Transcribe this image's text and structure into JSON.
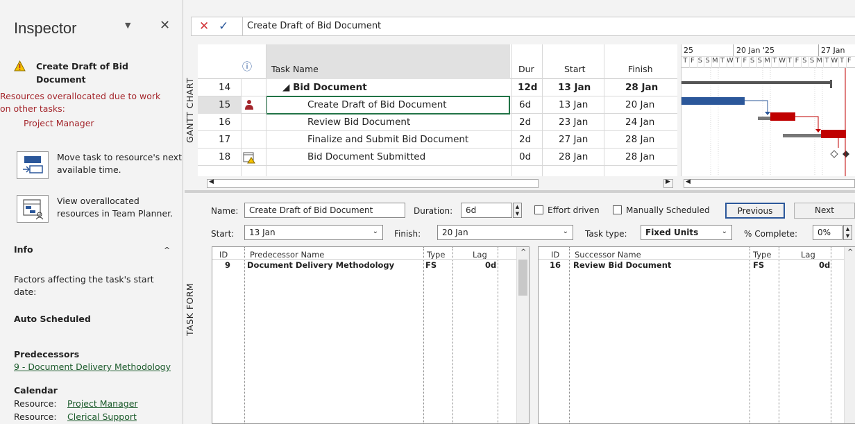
{
  "inspector": {
    "title": "Inspector",
    "warning_title": "Create Draft of Bid Document",
    "warning_text": "Resources overallocated due to work on other tasks:",
    "warning_resource": "Project Manager",
    "actions": [
      {
        "label": "Move task to resource's next available time."
      },
      {
        "label": "View overallocated resources in Team Planner."
      }
    ],
    "info_header": "Info",
    "factors": "Factors affecting the task's start date:",
    "auto_scheduled": "Auto Scheduled",
    "predecessors_header": "Predecessors",
    "predecessor_link": "9 - Document Delivery Methodology",
    "calendar_header": "Calendar",
    "resource_label": "Resource:",
    "resources": [
      "Project Manager",
      "Clerical Support"
    ]
  },
  "formula": {
    "value": "Create Draft of Bid Document"
  },
  "gantt": {
    "view_label": "GANTT CHART",
    "columns": {
      "info": "ⓘ",
      "task_name": "Task Name",
      "dur": "Dur",
      "start": "Start",
      "finish": "Finish"
    },
    "rows": [
      {
        "id": "14",
        "name": "◢ Bid Document",
        "dur": "12d",
        "start": "13 Jan",
        "finish": "28 Jan",
        "summary": true
      },
      {
        "id": "15",
        "name": "Create Draft of Bid Document",
        "dur": "6d",
        "start": "13 Jan",
        "finish": "20 Jan",
        "selected": true
      },
      {
        "id": "16",
        "name": "Review Bid Document",
        "dur": "2d",
        "start": "23 Jan",
        "finish": "24 Jan"
      },
      {
        "id": "17",
        "name": "Finalize and Submit Bid Document",
        "dur": "2d",
        "start": "27 Jan",
        "finish": "28 Jan"
      },
      {
        "id": "18",
        "name": "Bid Document Submitted",
        "dur": "0d",
        "start": "28 Jan",
        "finish": "28 Jan"
      }
    ],
    "timescale_top": [
      "25",
      "20 Jan '25",
      "27 Jan"
    ],
    "timescale_days": [
      "T",
      "F",
      "S",
      "S",
      "M",
      "T",
      "W",
      "T",
      "F",
      "S",
      "S",
      "M",
      "T",
      "W",
      "T",
      "F",
      "S",
      "S",
      "M",
      "T",
      "W",
      "T",
      "F"
    ]
  },
  "form": {
    "view_label": "TASK FORM",
    "name_label": "Name:",
    "name_value": "Create Draft of Bid Document",
    "duration_label": "Duration:",
    "duration_value": "6d",
    "effort_driven": "Effort driven",
    "manually_scheduled": "Manually Scheduled",
    "previous": "Previous",
    "next": "Next",
    "start_label": "Start:",
    "start_value": "13 Jan",
    "finish_label": "Finish:",
    "finish_value": "20 Jan",
    "task_type_label": "Task type:",
    "task_type_value": "Fixed Units",
    "complete_label": "% Complete:",
    "complete_value": "0%",
    "pred_headers": {
      "id": "ID",
      "name": "Predecessor Name",
      "type": "Type",
      "lag": "Lag"
    },
    "pred_rows": [
      {
        "id": "9",
        "name": "Document Delivery Methodology",
        "type": "FS",
        "lag": "0d"
      }
    ],
    "succ_headers": {
      "id": "ID",
      "name": "Successor Name",
      "type": "Type",
      "lag": "Lag"
    },
    "succ_rows": [
      {
        "id": "16",
        "name": "Review Bid Document",
        "type": "FS",
        "lag": "0d"
      }
    ]
  },
  "colors": {
    "accent": "#2b579a",
    "warning": "#a4262c",
    "critical": "#c00000",
    "link": "#1a5a2a"
  }
}
